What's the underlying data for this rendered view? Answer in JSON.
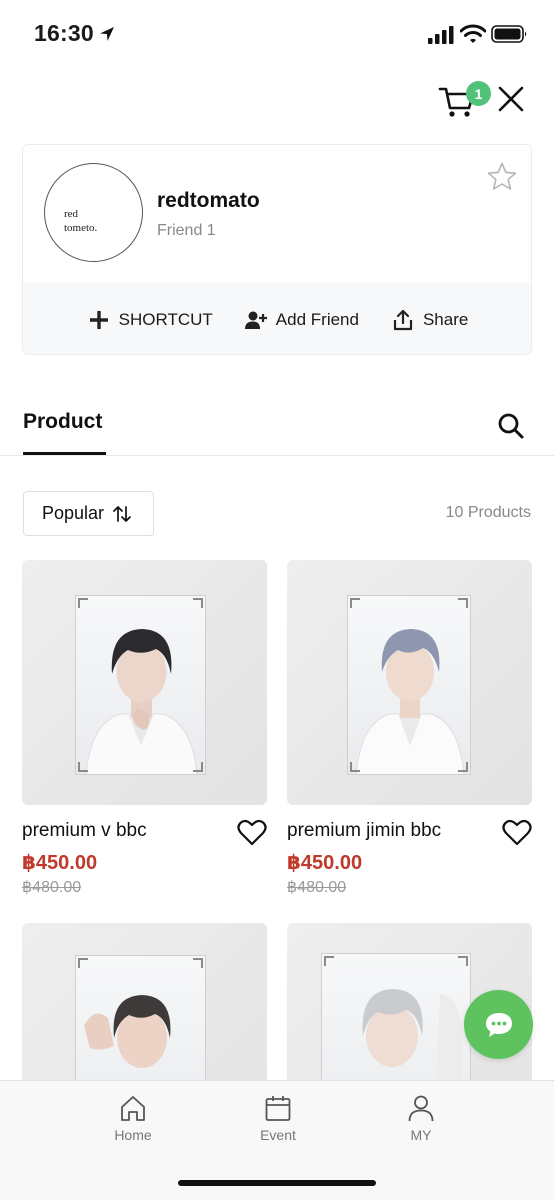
{
  "status_bar": {
    "time": "16:30"
  },
  "header": {
    "cart_count": "1"
  },
  "shop": {
    "logo_text": "red\ntometo.",
    "name": "redtomato",
    "friends": "Friend 1",
    "actions": {
      "shortcut": "SHORTCUT",
      "add_friend": "Add Friend",
      "share": "Share"
    }
  },
  "tabs": {
    "product": "Product"
  },
  "toolbar": {
    "sort_label": "Popular",
    "count": "10 Products"
  },
  "products": [
    {
      "name": "premium v bbc",
      "price": "฿450.00",
      "original_price": "฿480.00",
      "hair_color": "#2b2b2e"
    },
    {
      "name": "premium jimin bbc",
      "price": "฿450.00",
      "original_price": "฿480.00",
      "hair_color": "#8e96b0"
    },
    {
      "hair_color": "#3d3a39"
    },
    {
      "hair_color": "#c9cbce"
    }
  ],
  "bottom_nav": {
    "home": "Home",
    "event": "Event",
    "my": "MY"
  },
  "colors": {
    "accent_green": "#52c27a",
    "chat_green": "#5ec35f",
    "price_red": "#c0392b"
  }
}
